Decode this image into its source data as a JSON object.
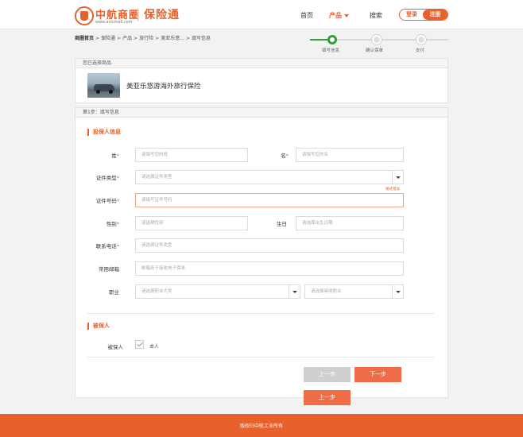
{
  "header": {
    "brand": "中航商圈",
    "brand_url": "www.avicmall.com",
    "product": "保险通",
    "nav": {
      "home": "首页",
      "products": "产品",
      "search": "搜索"
    },
    "login": "登录",
    "register": "注册"
  },
  "breadcrumb": {
    "items": [
      "商圈首页",
      "保险通",
      "产品",
      "旅行险",
      "美亚乐悠...",
      "填写信息"
    ],
    "sep": ">"
  },
  "progress": {
    "steps": [
      "填写信息",
      "确认保单",
      "支付"
    ],
    "current": 1
  },
  "selected": {
    "heading": "您已选择商品",
    "product_title": "美亚乐悠游海外旅行保险"
  },
  "form": {
    "step_heading": "第1步：填写信息",
    "applicant_title": "投保人信息",
    "fields": {
      "surname": {
        "label": "姓",
        "placeholder": "请填写您的姓"
      },
      "given_name": {
        "label": "名",
        "placeholder": "请填写您的名"
      },
      "id_type": {
        "label": "证件类型",
        "placeholder": "请选择证件类型"
      },
      "id_number": {
        "label": "证件号码",
        "placeholder": "请填写证件号码",
        "error": "格式错误"
      },
      "gender": {
        "label": "性别",
        "placeholder": "请选择性别"
      },
      "birthday": {
        "label": "生日",
        "placeholder": "请选择出生日期"
      },
      "phone": {
        "label": "联系电话",
        "placeholder": "请选择证件类型"
      },
      "email": {
        "label": "常用邮箱",
        "placeholder": "邮箱用于接收电子保单"
      },
      "job": {
        "label": "职业",
        "placeholder_category": "请选择职业大类",
        "placeholder_specific": "请选择具体职业"
      }
    },
    "required_mark": "*",
    "insured_title": "被保人",
    "insured_label": "被保人",
    "insured_self": "本人",
    "btn_prev": "上一步",
    "btn_next": "下一步"
  },
  "footer": {
    "copyright": "版权归中航工业所有"
  },
  "colors": {
    "accent": "#e8602c",
    "progress_done": "#32a033"
  }
}
